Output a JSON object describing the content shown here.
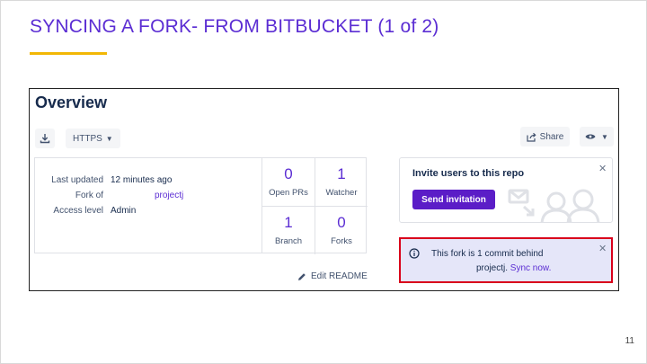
{
  "slide": {
    "title": "SYNCING A FORK- FROM BITBUCKET (1 of 2)",
    "page_number": "11",
    "accent_color": "#f2b705",
    "title_color": "#5b2dd3"
  },
  "overview": {
    "title": "Overview",
    "toolbar": {
      "download_icon": "download-icon",
      "protocol_label": "HTTPS",
      "share_label": "Share",
      "watch_icon": "eye-icon"
    },
    "info": {
      "last_updated_label": "Last updated",
      "last_updated_value": "12 minutes ago",
      "fork_of_label": "Fork of",
      "fork_of_value": "projectj",
      "access_level_label": "Access level",
      "access_level_value": "Admin"
    },
    "stats": [
      {
        "value": "0",
        "label": "Open PRs"
      },
      {
        "value": "1",
        "label": "Watcher"
      },
      {
        "value": "1",
        "label": "Branch"
      },
      {
        "value": "0",
        "label": "Forks"
      }
    ],
    "edit_readme_label": "Edit README",
    "invite": {
      "title": "Invite users to this repo",
      "button_label": "Send invitation"
    },
    "sync_alert": {
      "text_prefix": "This fork is 1 commit behind",
      "repo": "projectj.",
      "link_label": "Sync now.",
      "border_color": "#d9001b"
    }
  }
}
